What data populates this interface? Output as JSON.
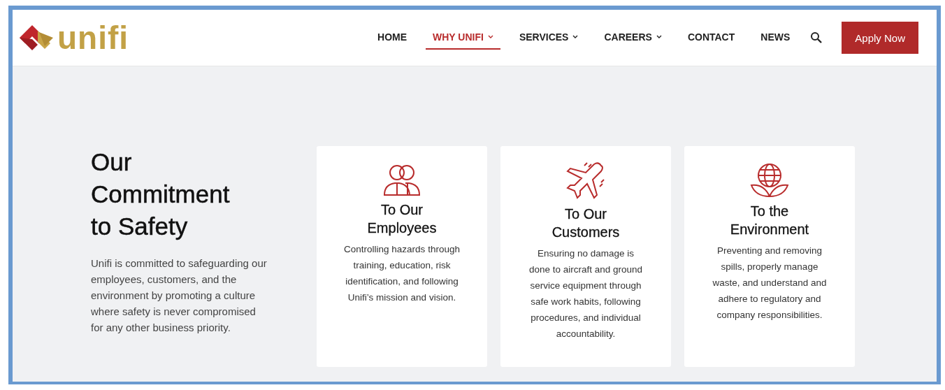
{
  "logo": {
    "text": "unifi"
  },
  "nav": {
    "items": [
      {
        "label": "HOME",
        "selected": false,
        "dropdown": false
      },
      {
        "label": "WHY UNIFI",
        "selected": true,
        "dropdown": true
      },
      {
        "label": "SERVICES",
        "selected": false,
        "dropdown": true
      },
      {
        "label": "CAREERS",
        "selected": false,
        "dropdown": true
      },
      {
        "label": "CONTACT",
        "selected": false,
        "dropdown": false
      },
      {
        "label": "NEWS",
        "selected": false,
        "dropdown": false
      }
    ],
    "cta": "Apply Now"
  },
  "intro": {
    "heading": "Our Commitment to Safety",
    "text": "Unifi is committed to safeguarding our employees, customers, and the environment by promoting a culture where safety is never compromised for any other business priority."
  },
  "cards": [
    {
      "kind": "people",
      "title": "To Our Employees",
      "text": "Controlling hazards through training, education, risk identification, and following Unifi’s mission and vision."
    },
    {
      "kind": "plane",
      "title": "To Our Customers",
      "text": "Ensuring no damage is done to aircraft and ground service equipment through safe work habits, following procedures, and individual accountability."
    },
    {
      "kind": "globe",
      "title": "To the Environment",
      "text": "Preventing and removing spills, properly manage waste, and understand and adhere to regulatory and company responsibilities."
    }
  ]
}
